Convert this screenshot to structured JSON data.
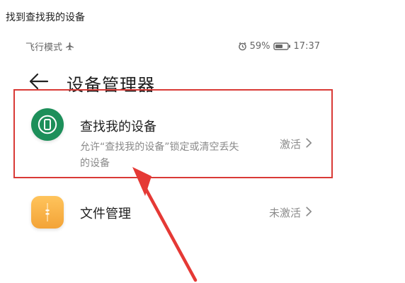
{
  "caption": "找到查找我的设备",
  "status_bar": {
    "mode": "飞行模式",
    "battery": "59%",
    "time": "17:37"
  },
  "header": {
    "title": "设备管理器"
  },
  "items": [
    {
      "title": "查找我的设备",
      "description": "允许“查找我的设备”锁定或清空丢失的设备",
      "status": "激活"
    },
    {
      "title": "文件管理",
      "status": "未激活"
    }
  ],
  "colors": {
    "highlight": "#d93a36",
    "find_icon": "#1d8f5a",
    "files_icon": "#f3a337"
  }
}
